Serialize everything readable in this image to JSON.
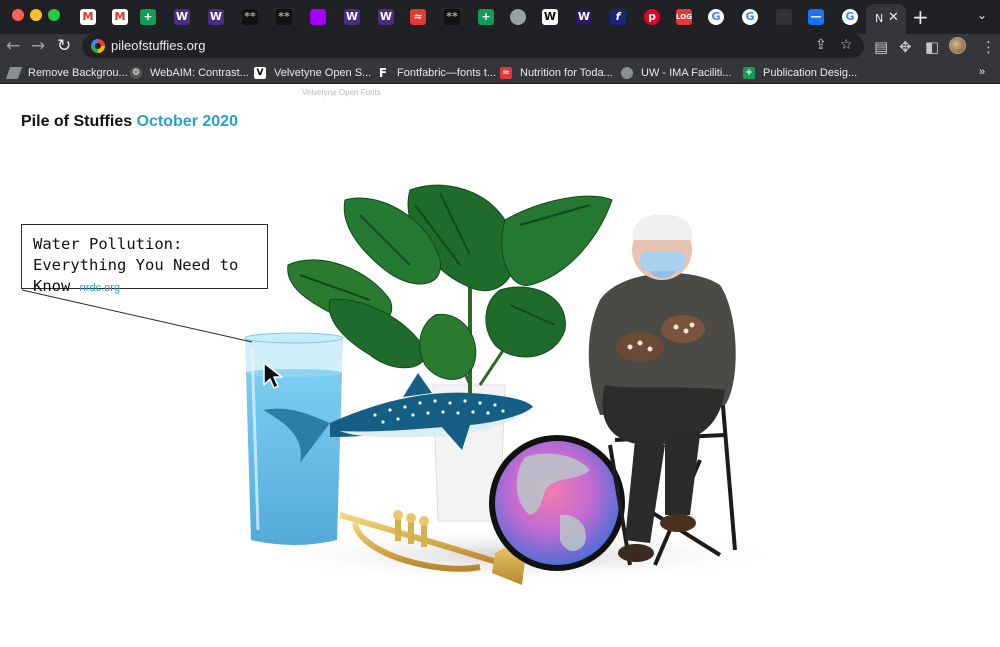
{
  "browser": {
    "active_tab_title": "N",
    "url": "pileofstuffies.org",
    "bookmarks": [
      {
        "label": "Remove Backgrou...",
        "icon": "layers-icon"
      },
      {
        "label": "WebAIM: Contrast...",
        "icon": "webaim-gear-icon"
      },
      {
        "label": "Velvetyne Open S...",
        "icon": "velvetyne-v-icon"
      },
      {
        "label": "Fontfabric—fonts t...",
        "icon": "fontfabric-f-icon"
      },
      {
        "label": "Nutrition for Toda...",
        "icon": "nutrition-logo-icon"
      },
      {
        "label": "UW - IMA Faciliti...",
        "icon": "globe-icon"
      },
      {
        "label": "Publication Desig...",
        "icon": "sheets-plus-icon"
      }
    ],
    "bookmarks_overflow": "»"
  },
  "page": {
    "faint_text": "Velvetyne Open Fonts",
    "site_name": "Pile of Stuffies",
    "month": "October 2020",
    "callout": {
      "title": "Water Pollution: Everything You Need to Know",
      "source": "nrdc.org"
    },
    "objects": [
      "glass-of-water",
      "monstera-plant",
      "whale-shark",
      "trumpet",
      "earth-globe",
      "man-on-folding-chair"
    ]
  },
  "colors": {
    "accent": "#2b9fcc",
    "chrome_dark": "#202124",
    "chrome_toolbar": "#35363a"
  }
}
